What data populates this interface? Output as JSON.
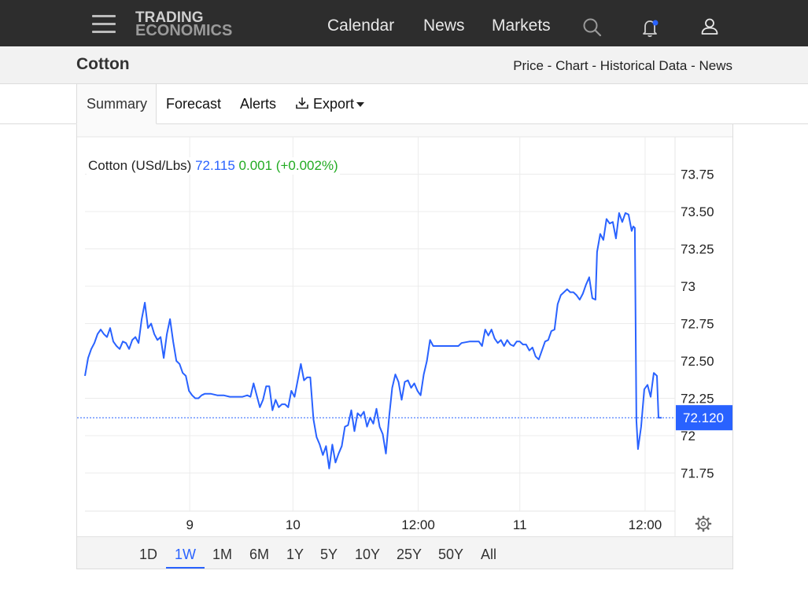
{
  "header": {
    "logo_line1": "TRADING",
    "logo_line2": "ECONOMICS",
    "nav": [
      "Calendar",
      "News",
      "Markets"
    ],
    "icons": [
      "menu-icon",
      "search-icon",
      "bell-icon",
      "user-icon"
    ],
    "notification_dot_color": "#2962ff"
  },
  "page": {
    "title": "Cotton",
    "breadcrumbs": [
      "Price",
      "Chart",
      "Historical Data",
      "News"
    ],
    "breadcrumb_sep": "-"
  },
  "tabs": {
    "summary": "Summary",
    "forecast": "Forecast",
    "alerts": "Alerts",
    "export": "Export"
  },
  "legend": {
    "name": "Cotton (USd/Lbs)",
    "value": "72.115",
    "change": "0.001 (+0.002%)"
  },
  "ranges": {
    "items": [
      "1D",
      "1W",
      "1M",
      "6M",
      "1Y",
      "5Y",
      "10Y",
      "25Y",
      "50Y",
      "All"
    ],
    "selected": "1W"
  },
  "colors": {
    "line": "#2962ff",
    "up": "#22ab22",
    "topbar": "#2d2d2d"
  },
  "chart_data": {
    "type": "line",
    "title": "",
    "xlabel": "",
    "ylabel": "",
    "ylim": [
      71.5,
      73.95
    ],
    "x_range": [
      0,
      749
    ],
    "y_ticks": [
      "73.75",
      "73.50",
      "73.25",
      "73",
      "72.75",
      "72.50",
      "72.25",
      "72",
      "71.75"
    ],
    "y_tick_values": [
      73.75,
      73.5,
      73.25,
      73.0,
      72.75,
      72.5,
      72.25,
      72.0,
      71.75
    ],
    "x_ticks": [
      {
        "label": "9",
        "x": 133
      },
      {
        "label": "10",
        "x": 264
      },
      {
        "label": "12:00",
        "x": 423
      },
      {
        "label": "11",
        "x": 552
      },
      {
        "label": "12:00",
        "x": 711
      }
    ],
    "last_price_label": "72.120",
    "last_price": 72.12,
    "series": [
      {
        "name": "Cotton (USd/Lbs)",
        "points": [
          [
            0,
            72.4
          ],
          [
            4,
            72.52
          ],
          [
            8,
            72.58
          ],
          [
            12,
            72.62
          ],
          [
            16,
            72.68
          ],
          [
            20,
            72.71
          ],
          [
            24,
            72.68
          ],
          [
            28,
            72.66
          ],
          [
            32,
            72.72
          ],
          [
            36,
            72.63
          ],
          [
            40,
            72.6
          ],
          [
            44,
            72.58
          ],
          [
            48,
            72.63
          ],
          [
            52,
            72.62
          ],
          [
            56,
            72.58
          ],
          [
            60,
            72.64
          ],
          [
            64,
            72.66
          ],
          [
            68,
            72.62
          ],
          [
            72,
            72.78
          ],
          [
            76,
            72.89
          ],
          [
            80,
            72.72
          ],
          [
            84,
            72.75
          ],
          [
            88,
            72.68
          ],
          [
            92,
            72.64
          ],
          [
            96,
            72.66
          ],
          [
            100,
            72.52
          ],
          [
            104,
            72.68
          ],
          [
            108,
            72.78
          ],
          [
            112,
            72.63
          ],
          [
            116,
            72.5
          ],
          [
            120,
            72.48
          ],
          [
            124,
            72.42
          ],
          [
            128,
            72.4
          ],
          [
            132,
            72.3
          ],
          [
            136,
            72.27
          ],
          [
            140,
            72.25
          ],
          [
            144,
            72.25
          ],
          [
            148,
            72.27
          ],
          [
            152,
            72.28
          ],
          [
            160,
            72.28
          ],
          [
            168,
            72.27
          ],
          [
            176,
            72.27
          ],
          [
            184,
            72.26
          ],
          [
            192,
            72.26
          ],
          [
            200,
            72.26
          ],
          [
            206,
            72.27
          ],
          [
            210,
            72.26
          ],
          [
            214,
            72.35
          ],
          [
            218,
            72.27
          ],
          [
            222,
            72.19
          ],
          [
            226,
            72.24
          ],
          [
            230,
            72.33
          ],
          [
            234,
            72.33
          ],
          [
            238,
            72.17
          ],
          [
            242,
            72.24
          ],
          [
            246,
            72.19
          ],
          [
            250,
            72.21
          ],
          [
            254,
            72.21
          ],
          [
            258,
            72.19
          ],
          [
            262,
            72.3
          ],
          [
            266,
            72.26
          ],
          [
            270,
            72.37
          ],
          [
            274,
            72.48
          ],
          [
            278,
            72.37
          ],
          [
            282,
            72.39
          ],
          [
            286,
            72.39
          ],
          [
            290,
            72.11
          ],
          [
            294,
            71.99
          ],
          [
            298,
            71.94
          ],
          [
            302,
            71.87
          ],
          [
            306,
            71.93
          ],
          [
            310,
            71.78
          ],
          [
            314,
            71.94
          ],
          [
            318,
            71.82
          ],
          [
            322,
            71.88
          ],
          [
            326,
            71.93
          ],
          [
            330,
            72.06
          ],
          [
            334,
            72.07
          ],
          [
            338,
            72.17
          ],
          [
            342,
            72.03
          ],
          [
            346,
            72.15
          ],
          [
            350,
            72.13
          ],
          [
            354,
            72.16
          ],
          [
            358,
            72.06
          ],
          [
            362,
            72.12
          ],
          [
            366,
            72.08
          ],
          [
            370,
            72.18
          ],
          [
            374,
            72.06
          ],
          [
            378,
            72.01
          ],
          [
            382,
            71.88
          ],
          [
            386,
            72.12
          ],
          [
            390,
            72.32
          ],
          [
            394,
            72.41
          ],
          [
            398,
            72.36
          ],
          [
            402,
            72.24
          ],
          [
            406,
            72.36
          ],
          [
            410,
            72.37
          ],
          [
            414,
            72.32
          ],
          [
            418,
            72.35
          ],
          [
            422,
            72.3
          ],
          [
            426,
            72.27
          ],
          [
            430,
            72.41
          ],
          [
            434,
            72.5
          ],
          [
            438,
            72.64
          ],
          [
            442,
            72.6
          ],
          [
            450,
            72.6
          ],
          [
            460,
            72.6
          ],
          [
            470,
            72.6
          ],
          [
            474,
            72.6
          ],
          [
            478,
            72.62
          ],
          [
            488,
            72.63
          ],
          [
            500,
            72.63
          ],
          [
            504,
            72.6
          ],
          [
            508,
            72.71
          ],
          [
            512,
            72.67
          ],
          [
            516,
            72.71
          ],
          [
            520,
            72.65
          ],
          [
            524,
            72.62
          ],
          [
            528,
            72.64
          ],
          [
            532,
            72.6
          ],
          [
            536,
            72.64
          ],
          [
            540,
            72.61
          ],
          [
            544,
            72.6
          ],
          [
            548,
            72.63
          ],
          [
            552,
            72.63
          ],
          [
            556,
            72.61
          ],
          [
            560,
            72.61
          ],
          [
            564,
            72.57
          ],
          [
            568,
            72.59
          ],
          [
            572,
            72.53
          ],
          [
            576,
            72.51
          ],
          [
            580,
            72.57
          ],
          [
            584,
            72.63
          ],
          [
            588,
            72.64
          ],
          [
            592,
            72.7
          ],
          [
            596,
            72.71
          ],
          [
            600,
            72.88
          ],
          [
            604,
            72.94
          ],
          [
            608,
            72.96
          ],
          [
            612,
            72.98
          ],
          [
            616,
            72.96
          ],
          [
            620,
            72.96
          ],
          [
            624,
            72.94
          ],
          [
            628,
            72.91
          ],
          [
            632,
            72.95
          ],
          [
            636,
            73.01
          ],
          [
            640,
            73.06
          ],
          [
            644,
            72.92
          ],
          [
            648,
            72.91
          ],
          [
            650,
            73.23
          ],
          [
            654,
            73.35
          ],
          [
            658,
            73.31
          ],
          [
            662,
            73.45
          ],
          [
            666,
            73.42
          ],
          [
            670,
            73.43
          ],
          [
            674,
            73.32
          ],
          [
            678,
            73.49
          ],
          [
            682,
            73.43
          ],
          [
            686,
            73.49
          ],
          [
            690,
            73.48
          ],
          [
            694,
            73.37
          ],
          [
            696,
            73.4
          ],
          [
            698,
            73.39
          ],
          [
            700,
            72.1
          ],
          [
            702,
            71.91
          ],
          [
            706,
            72.06
          ],
          [
            710,
            72.31
          ],
          [
            714,
            72.34
          ],
          [
            718,
            72.26
          ],
          [
            722,
            72.42
          ],
          [
            726,
            72.4
          ],
          [
            728,
            72.12
          ],
          [
            732,
            72.12
          ]
        ]
      }
    ]
  }
}
